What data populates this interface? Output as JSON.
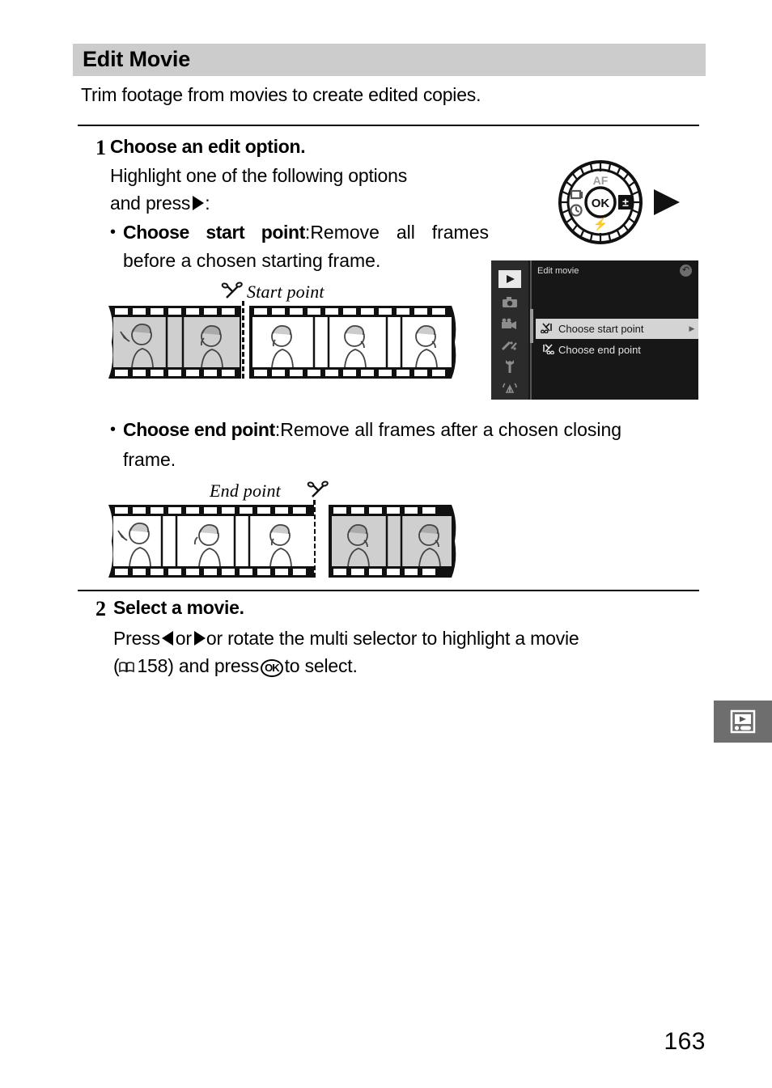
{
  "page": {
    "number": "163",
    "section_title": "Edit Movie",
    "intro": "Trim footage from movies to create edited copies."
  },
  "steps": [
    {
      "number": "1",
      "heading": "Choose an edit option.",
      "line1": "Highlight one of the following options",
      "line2_prefix": "and press",
      "line2_suffix": ":",
      "bullets": [
        {
          "term": "Choose start point",
          "colon": ":",
          "line1": "Remove  all  frames",
          "line2": "before a chosen starting frame."
        },
        {
          "term": "Choose end point",
          "colon": ":",
          "line1": "Remove  all  frames  after  a  chosen  closing",
          "line2": "frame."
        }
      ]
    },
    {
      "number": "2",
      "heading": "Select a movie.",
      "line1_a": "Press",
      "line1_b": "or",
      "line1_c": "or rotate the multi selector to highlight a movie",
      "line2_a": "(",
      "line2_page_ref": "158",
      "line2_b": ") and press",
      "line2_c": "to select."
    }
  ],
  "dial": {
    "name": "multi-selector",
    "top_label": "AF",
    "center_label": "OK",
    "right_label": "exposure-compensation",
    "bottom_label": "flash",
    "left_label_upper": "release-mode",
    "left_label_lower": "self-timer",
    "press_direction": "right"
  },
  "camera_menu": {
    "title": "Edit movie",
    "back_icon": "back-arrow-icon",
    "sidebar_icons": [
      {
        "name": "playback-menu-icon",
        "glyph": "▶",
        "active": true
      },
      {
        "name": "photo-shooting-menu-icon",
        "glyph": "■",
        "active": false
      },
      {
        "name": "movie-shooting-menu-icon",
        "glyph": "■",
        "active": false
      },
      {
        "name": "retouch-menu-icon",
        "glyph": "■",
        "active": false
      },
      {
        "name": "setup-menu-icon",
        "glyph": "Y",
        "active": false
      },
      {
        "name": "wireless-menu-icon",
        "glyph": "((Υ))",
        "active": false
      }
    ],
    "rows": [
      {
        "icon": "scissors-start-icon",
        "label": "Choose start point",
        "selected": true,
        "arrow": "▶"
      },
      {
        "icon": "scissors-end-icon",
        "label": "Choose end point",
        "selected": false,
        "arrow": ""
      }
    ]
  },
  "figures": [
    {
      "name": "start-point-film-strip",
      "caption": "Start point",
      "scissors_icon": "scissors-icon",
      "left_segment": {
        "state": "removed",
        "shading": "gray",
        "frames": 2
      },
      "right_segment": {
        "state": "kept",
        "shading": "white",
        "frames": 3
      }
    },
    {
      "name": "end-point-film-strip",
      "caption": "End point",
      "scissors_icon": "scissors-icon",
      "left_segment": {
        "state": "kept",
        "shading": "white",
        "frames": 3
      },
      "right_segment": {
        "state": "removed",
        "shading": "gray",
        "frames": 2
      }
    }
  ],
  "side_tab": {
    "name": "retouch-section-tab",
    "icon": "movie-playback-icon"
  },
  "colors": {
    "header_band": "#cccccc",
    "menu_background": "#171717",
    "menu_sidebar": "#2b2b2b",
    "menu_selected_row": "#d4d4d4",
    "film_removed_frame": "#cfcfcf",
    "side_tab": "#6e6e6e"
  }
}
